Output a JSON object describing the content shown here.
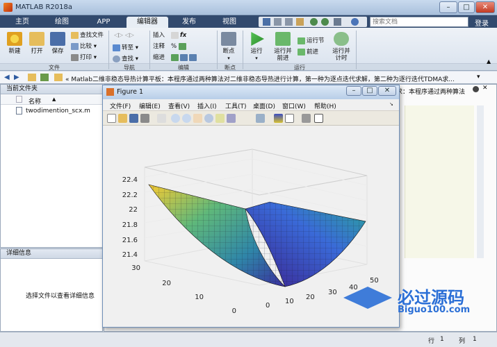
{
  "app": {
    "title": "MATLAB R2018a"
  },
  "tabs": [
    {
      "label": "主页"
    },
    {
      "label": "绘图"
    },
    {
      "label": "APP"
    },
    {
      "label": "编辑器",
      "active": true
    },
    {
      "label": "发布"
    },
    {
      "label": "视图"
    }
  ],
  "search": {
    "placeholder": "搜索文档"
  },
  "login": "登录",
  "ribbon": {
    "file": {
      "new": "新建",
      "open": "打开",
      "save": "保存",
      "find_files": "查找文件",
      "compare": "比较",
      "print": "打印",
      "section": "文件"
    },
    "nav": {
      "goto": "转至",
      "find": "查找",
      "section": "导航"
    },
    "edit": {
      "insert": "插入",
      "comment": "注释",
      "indent": "缩进",
      "fx": "fx",
      "section": "编辑"
    },
    "breakpoints": {
      "label": "断点",
      "section": "断点"
    },
    "run": {
      "run": "运行",
      "run_advance": "运行并\n前进",
      "run_section": "运行节",
      "advance": "前进",
      "run_time": "运行并\n计时",
      "section": "运行"
    }
  },
  "address": {
    "text": "« Matlab二维非稳态导热计算平板：本程序通过两种算法对二维非稳态导热进行计算，第一种为逐点迭代求解，第二种为逐行迭代TDMA求...",
    "right_text": "求：本程序通过两种算法"
  },
  "current_folder": {
    "title": "当前文件夹",
    "col_name": "名称",
    "sort_arrow": "▲",
    "files": [
      {
        "name": "twodimention_scx.m"
      }
    ]
  },
  "details": {
    "title": "详细信息",
    "empty_text": "选择文件以查看详细信息"
  },
  "figure": {
    "title": "Figure 1",
    "menu": [
      "文件(F)",
      "编辑(E)",
      "查看(V)",
      "插入(I)",
      "工具(T)",
      "桌面(D)",
      "窗口(W)",
      "帮助(H)"
    ]
  },
  "plot": {
    "z_ticks": [
      "22.4",
      "22.2",
      "22",
      "21.8",
      "21.6",
      "21.4"
    ],
    "y_ticks": [
      "30",
      "20",
      "10",
      "0"
    ],
    "x_ticks": [
      "0",
      "10",
      "20",
      "30",
      "40",
      "50"
    ],
    "surface": "parabolic-sheet"
  },
  "watermark": {
    "main": "必过源码",
    "sub": "Biguo100.com"
  },
  "status": {
    "row_label": "行",
    "row": "1",
    "col_label": "列",
    "col": "1"
  },
  "colors": {
    "ribbon_tab_bar": "#324a6e",
    "accent": "#2f5ca8"
  }
}
